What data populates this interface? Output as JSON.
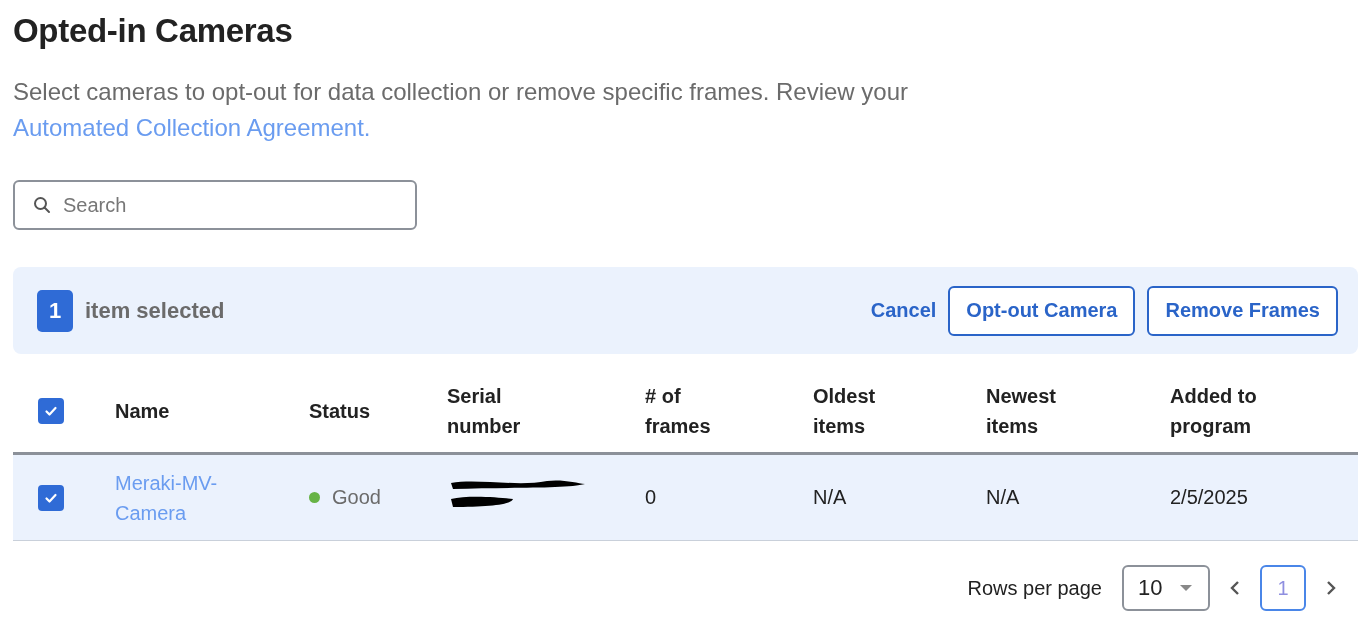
{
  "title": "Opted-in Cameras",
  "description": {
    "text": "Select cameras to opt-out for data collection or remove specific frames. Review your ",
    "link": "Automated Collection Agreement."
  },
  "search": {
    "placeholder": "Search"
  },
  "selection_bar": {
    "count": "1",
    "label": "item selected",
    "cancel": "Cancel",
    "buttons": [
      "Opt-out Camera",
      "Remove Frames"
    ]
  },
  "table": {
    "select_all_checked": true,
    "columns": [
      "Name",
      "Status",
      "Serial number",
      "# of frames",
      "Oldest items",
      "Newest items",
      "Added to program"
    ],
    "rows": [
      {
        "checked": true,
        "selected": true,
        "name": "Meraki-MV-Camera",
        "status": "Good",
        "color": "#67b346",
        "serial_redacted": true,
        "frames": "0",
        "oldest": "N/A",
        "newest": "N/A",
        "added": "2/5/2025"
      }
    ]
  },
  "pagination": {
    "rows_label": "Rows per page",
    "rows_value": "10",
    "pages": [
      {
        "label": "1",
        "selected": true
      }
    ]
  }
}
